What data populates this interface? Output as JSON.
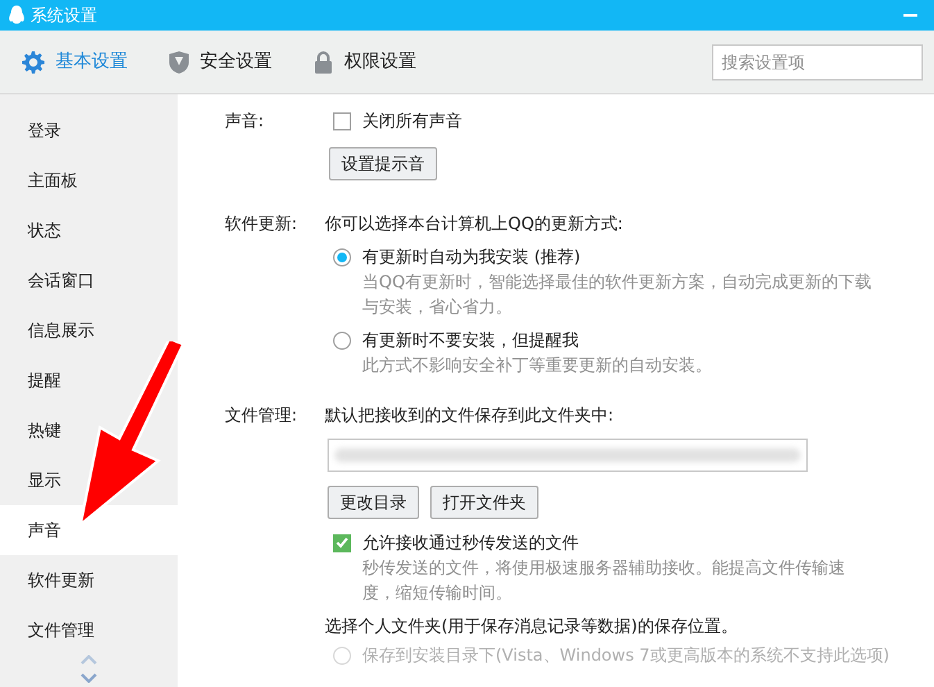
{
  "window": {
    "title": "系统设置"
  },
  "tabs": [
    {
      "label": "基本设置",
      "kind": "gear",
      "selected": true
    },
    {
      "label": "安全设置",
      "kind": "shield",
      "selected": false
    },
    {
      "label": "权限设置",
      "kind": "lock",
      "selected": false
    }
  ],
  "search": {
    "placeholder": "搜索设置项"
  },
  "sidebar": {
    "items": [
      {
        "label": "登录",
        "selected": false
      },
      {
        "label": "主面板",
        "selected": false
      },
      {
        "label": "状态",
        "selected": false
      },
      {
        "label": "会话窗口",
        "selected": false
      },
      {
        "label": "信息展示",
        "selected": false
      },
      {
        "label": "提醒",
        "selected": false
      },
      {
        "label": "热键",
        "selected": false
      },
      {
        "label": "显示",
        "selected": false
      },
      {
        "label": "声音",
        "selected": true
      },
      {
        "label": "软件更新",
        "selected": false
      },
      {
        "label": "文件管理",
        "selected": false
      }
    ]
  },
  "sound": {
    "label": "声音:",
    "mute_all": {
      "label": "关闭所有声音",
      "checked": false
    },
    "button": "设置提示音"
  },
  "update": {
    "label": "软件更新:",
    "intro": "你可以选择本台计算机上QQ的更新方式:",
    "options": [
      {
        "label": "有更新时自动为我安装 (推荐)",
        "description": "当QQ有更新时，智能选择最佳的软件更新方案，自动完成更新的下载与安装，省心省力。",
        "selected": true
      },
      {
        "label": "有更新时不要安装，但提醒我",
        "description": "此方式不影响安全补丁等重要更新的自动安装。",
        "selected": false
      }
    ]
  },
  "files": {
    "label": "文件管理:",
    "intro": "默认把接收到的文件保存到此文件夹中:",
    "buttons": [
      "更改目录",
      "打开文件夹"
    ],
    "fast_transfer": {
      "label": "允许接收通过秒传发送的文件",
      "description": "秒传发送的文件，将使用极速服务器辅助接收。能提高文件传输速度，缩短传输时间。",
      "checked": true
    },
    "personal_folder": {
      "intro": "选择个人文件夹(用于保存消息记录等数据)的保存位置。",
      "options": [
        {
          "label": "保存到安装目录下(Vista、Windows 7或更高版本的系统不支持此选项)",
          "selected": false,
          "disabled": true
        }
      ]
    }
  }
}
